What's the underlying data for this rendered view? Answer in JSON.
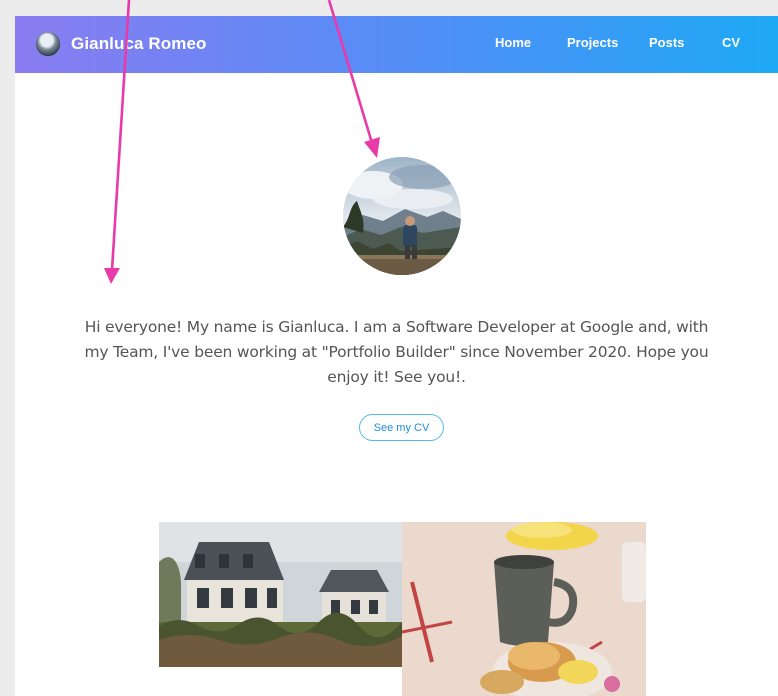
{
  "navbar": {
    "brand_name": "Gianluca Romeo",
    "links": [
      {
        "label": "Home"
      },
      {
        "label": "Projects"
      },
      {
        "label": "Posts"
      },
      {
        "label": "CV"
      }
    ]
  },
  "profile": {
    "intro_text": "Hi everyone! My name is Gianluca. I am a Software Developer at Google and, with my Team, I've been working at \"Portfolio Builder\" since November 2020. Hope you enjoy it! See you!.",
    "cv_button_label": "See my CV"
  },
  "colors": {
    "nav_gradient_start": "#8a7cf0",
    "nav_gradient_end": "#1ea9f6",
    "accent": "#1e8ed8",
    "annotation_arrow": "#e83aa8"
  }
}
